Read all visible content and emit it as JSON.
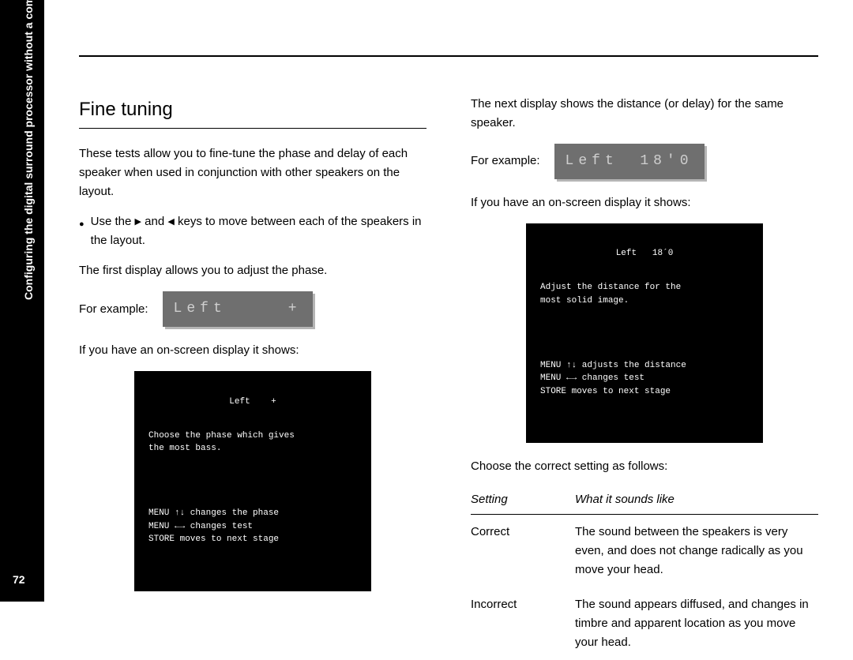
{
  "side": {
    "label": "Configuring the digital surround processor without a computer",
    "page_number": "72"
  },
  "col_left": {
    "heading": "Fine tuning",
    "p1": "These tests allow you to fine-tune the phase and delay of each speaker when used in conjunction with other speakers on the layout.",
    "bullet_pre": "Use the ",
    "bullet_mid": " and ",
    "bullet_post": " keys to move between each of the speakers in the layout.",
    "p2": "The first display allows you to adjust the phase.",
    "example_label": "For example:",
    "lcd1_left": "Left",
    "lcd1_right": "+",
    "p3": "If you have an on-screen display it shows:",
    "osd1_head": "Left    +",
    "osd1_body1": "Choose the phase which gives\nthe most bass.",
    "osd1_body2": "MENU ↑↓ changes the phase\nMENU ←→ changes test\nSTORE moves to next stage"
  },
  "col_right": {
    "p1": "The next display shows the distance (or delay) for the same speaker.",
    "example_label": "For example:",
    "lcd2_left": "Left",
    "lcd2_right": "18'0",
    "p2": "If you have an on-screen display it shows:",
    "osd2_head": "Left   18´0",
    "osd2_body1": "Adjust the distance for the\nmost solid image.",
    "osd2_body2": "MENU ↑↓ adjusts the distance\nMENU ←→ changes test\nSTORE moves to next stage",
    "p3": "Choose the correct setting as follows:",
    "table": {
      "th1": "Setting",
      "th2": "What it sounds like",
      "r1c1": "Correct",
      "r1c2": "The sound between the speakers is very even, and does not change radically as you move your head.",
      "r2c1": "Incorrect",
      "r2c2": "The sound appears diffused, and changes in timbre and apparent location as you move your head."
    }
  }
}
